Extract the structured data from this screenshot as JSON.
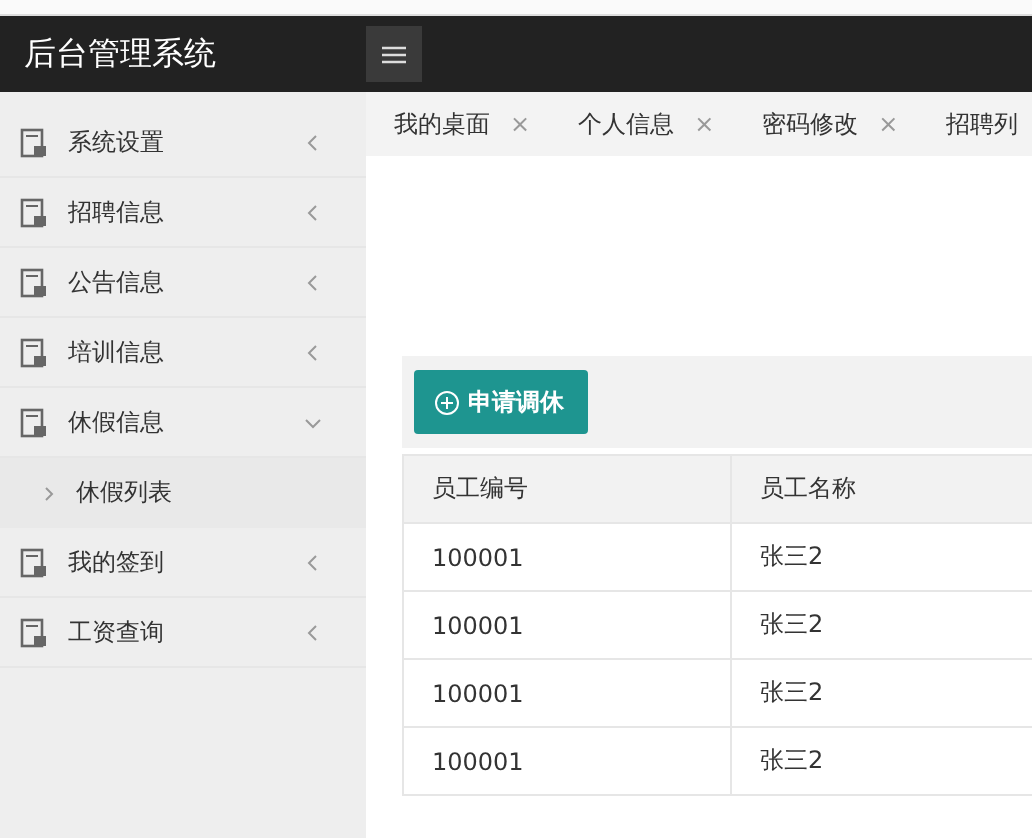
{
  "header": {
    "title": "后台管理系统"
  },
  "sidebar": {
    "items": [
      {
        "label": "系统设置",
        "expanded": false
      },
      {
        "label": "招聘信息",
        "expanded": false
      },
      {
        "label": "公告信息",
        "expanded": false
      },
      {
        "label": "培训信息",
        "expanded": false
      },
      {
        "label": "休假信息",
        "expanded": true,
        "children": [
          {
            "label": "休假列表"
          }
        ]
      },
      {
        "label": "我的签到",
        "expanded": false
      },
      {
        "label": "工资查询",
        "expanded": false
      }
    ]
  },
  "tabs": [
    {
      "label": "我的桌面",
      "close": "×"
    },
    {
      "label": "个人信息",
      "close": "×"
    },
    {
      "label": "密码修改",
      "close": "×"
    },
    {
      "label": "招聘列"
    }
  ],
  "toolbar": {
    "button": "申请调休"
  },
  "table": {
    "columns": [
      "员工编号",
      "员工名称"
    ],
    "rows": [
      [
        "100001",
        "张三2"
      ],
      [
        "100001",
        "张三2"
      ],
      [
        "100001",
        "张三2"
      ],
      [
        "100001",
        "张三2"
      ]
    ]
  }
}
